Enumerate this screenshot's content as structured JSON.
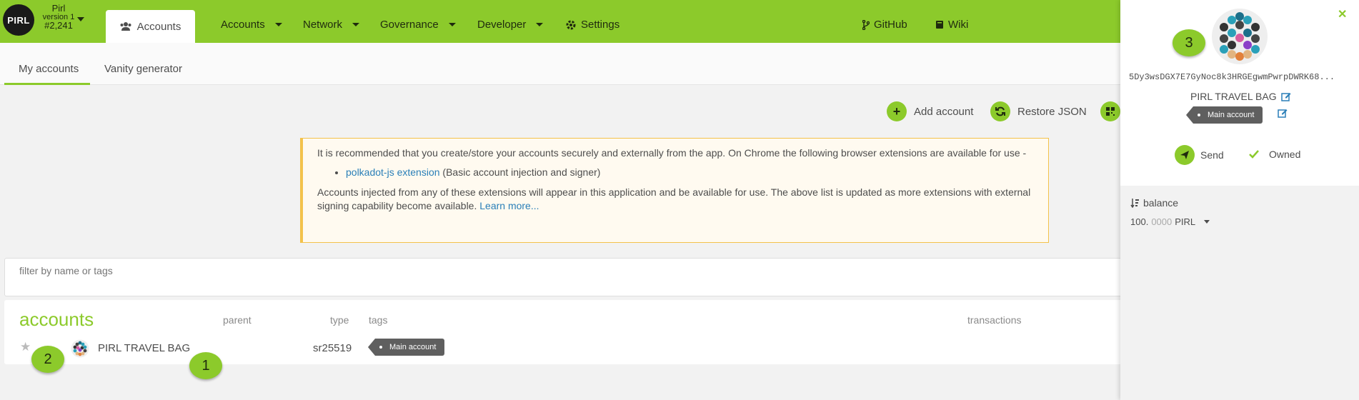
{
  "chain": {
    "logo_text": "PIRL",
    "name": "Pirl",
    "version": "version 1",
    "block": "#2,241"
  },
  "topnav": {
    "active_tab": "Accounts",
    "items": [
      {
        "label": "Accounts"
      },
      {
        "label": "Network"
      },
      {
        "label": "Governance"
      },
      {
        "label": "Developer"
      },
      {
        "label": "Settings"
      }
    ],
    "links": [
      {
        "label": "GitHub"
      },
      {
        "label": "Wiki"
      }
    ]
  },
  "subtabs": [
    {
      "label": "My accounts"
    },
    {
      "label": "Vanity generator"
    }
  ],
  "actions": {
    "add_account": "Add account",
    "restore_json": "Restore JSON"
  },
  "warning": {
    "text1": "It is recommended that you create/store your accounts securely and externally from the app. On Chrome the following browser extensions are available for use -",
    "ext_link": "polkadot-js extension",
    "ext_desc": " (Basic account injection and signer)",
    "text2": "Accounts injected from any of these extensions will appear in this application and be available for use. The above list is updated as more extensions with external signing capability become available. ",
    "learn_more": "Learn more..."
  },
  "filter": {
    "placeholder": "filter by name or tags"
  },
  "accounts_table": {
    "title": "accounts",
    "headers": {
      "parent": "parent",
      "type": "type",
      "tags": "tags",
      "transactions": "transactions"
    },
    "rows": [
      {
        "name": "PIRL TRAVEL BAG",
        "type": "sr25519",
        "tag": "Main account"
      }
    ]
  },
  "markers": {
    "m1": "1",
    "m2": "2",
    "m3": "3"
  },
  "panel": {
    "address": "5Dy3wsDGX7E7GyNoc8k3HRGEgwmPwrpDWRK68...",
    "name": "PIRL TRAVEL BAG",
    "tag": "Main account",
    "send": "Send",
    "owned": "Owned",
    "balance_label": "balance",
    "balance_int": "100.",
    "balance_dec": "0000",
    "balance_unit": "PIRL"
  },
  "colors": {
    "accent": "#8cca2b",
    "link": "#2a7fb8",
    "warning_border": "#f3c24b",
    "tag_bg": "#5f5f5f"
  }
}
